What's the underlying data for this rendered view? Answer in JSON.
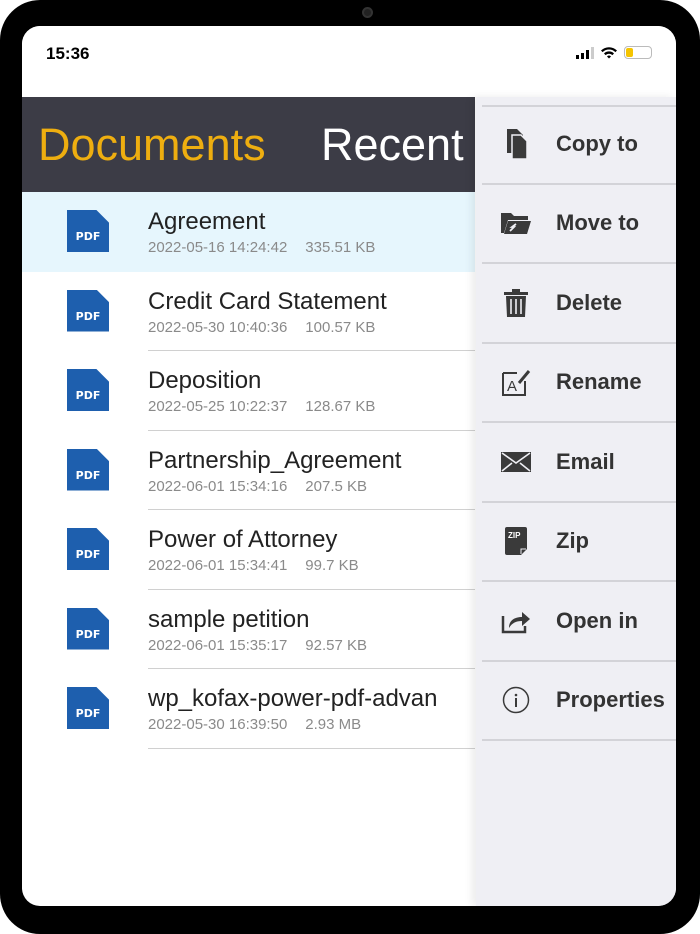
{
  "status": {
    "time": "15:36"
  },
  "tabs": {
    "documents": "Documents",
    "recent": "Recent"
  },
  "files": [
    {
      "name": "Agreement",
      "date": "2022-05-16 14:24:42",
      "size": "335.51 KB",
      "type": "PDF"
    },
    {
      "name": "Credit Card Statement",
      "date": "2022-05-30 10:40:36",
      "size": "100.57 KB",
      "type": "PDF"
    },
    {
      "name": "Deposition",
      "date": "2022-05-25 10:22:37",
      "size": "128.67 KB",
      "type": "PDF"
    },
    {
      "name": "Partnership_Agreement",
      "date": "2022-06-01 15:34:16",
      "size": "207.5 KB",
      "type": "PDF"
    },
    {
      "name": "Power of Attorney",
      "date": "2022-06-01 15:34:41",
      "size": "99.7 KB",
      "type": "PDF"
    },
    {
      "name": "sample petition",
      "date": "2022-06-01 15:35:17",
      "size": "92.57 KB",
      "type": "PDF"
    },
    {
      "name": "wp_kofax-power-pdf-advan",
      "date": "2022-05-30 16:39:50",
      "size": "2.93 MB",
      "type": "PDF"
    }
  ],
  "menu": [
    {
      "label": "Copy to",
      "icon": "copy-icon"
    },
    {
      "label": "Move to",
      "icon": "move-folder-icon"
    },
    {
      "label": "Delete",
      "icon": "trash-icon"
    },
    {
      "label": "Rename",
      "icon": "rename-icon"
    },
    {
      "label": "Email",
      "icon": "envelope-icon"
    },
    {
      "label": "Zip",
      "icon": "zip-icon"
    },
    {
      "label": "Open in",
      "icon": "share-icon"
    },
    {
      "label": "Properties",
      "icon": "info-icon"
    }
  ],
  "colors": {
    "accent": "#eeae10",
    "header": "#3c3c46",
    "selected": "#e6f6fd",
    "pdf": "#1e5fae"
  }
}
